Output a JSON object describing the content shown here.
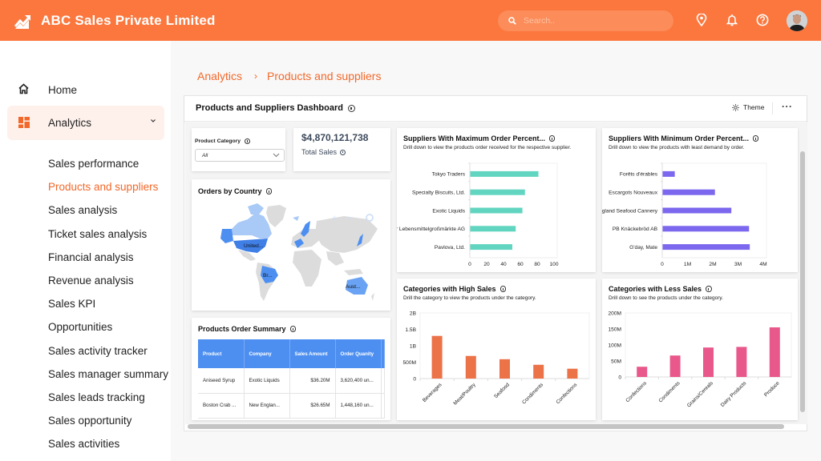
{
  "header": {
    "brand_title": "ABC Sales Private Limited",
    "search_placeholder": "Search..",
    "icons": [
      "trending-up-icon",
      "search-icon",
      "location-pin-icon",
      "bell-icon",
      "help-icon",
      "user-avatar"
    ]
  },
  "sidebar": {
    "home_label": "Home",
    "analytics_label": "Analytics",
    "sub_items": [
      {
        "label": "Sales performance",
        "active": false
      },
      {
        "label": "Products and suppliers",
        "active": true
      },
      {
        "label": "Sales analysis",
        "active": false
      },
      {
        "label": "Ticket sales analysis",
        "active": false
      },
      {
        "label": "Financial analysis",
        "active": false
      },
      {
        "label": "Revenue analysis",
        "active": false
      },
      {
        "label": "Sales KPI",
        "active": false
      },
      {
        "label": "Opportunities",
        "active": false
      },
      {
        "label": "Sales activity tracker",
        "active": false
      },
      {
        "label": "Sales manager summary",
        "active": false
      },
      {
        "label": "Sales leads tracking",
        "active": false
      },
      {
        "label": "Sales opportunity",
        "active": false
      },
      {
        "label": "Sales activities",
        "active": false
      }
    ]
  },
  "breadcrumb": {
    "items": [
      "Analytics",
      "Products and suppliers"
    ],
    "separator": "›"
  },
  "dashboard": {
    "title": "Products and Suppliers Dashboard",
    "theme_label": "Theme",
    "more_label": "···",
    "filter": {
      "label": "Product Category",
      "selected": "All"
    },
    "kpi": {
      "value": "$4,870,121,738",
      "label": "Total Sales"
    },
    "map": {
      "title": "Orders by Country",
      "labels": [
        "United...",
        "Br...",
        "Aust..."
      ],
      "zoom_controls": [
        "+",
        "−",
        "reset"
      ]
    },
    "table": {
      "title": "Products Order Summary",
      "columns": [
        "Product",
        "Company",
        "Sales Amount",
        "Order Quanity"
      ],
      "rows": [
        [
          "Aniseed Syrup",
          "Exotic Liquids",
          "$36.20M",
          "3,620,400 un..."
        ],
        [
          "Boston Crab ...",
          "New Englan...",
          "$26.65M",
          "1,448,160 un..."
        ]
      ]
    }
  },
  "colors": {
    "brand": "#fb773d",
    "accent_text": "#f2682a",
    "teal_bar": "#62d5c0",
    "purple_bar": "#7b68ee",
    "orange_bar": "#ec7248",
    "pink_bar": "#e9588b",
    "table_header": "#4d8ff0"
  },
  "chart_data": [
    {
      "id": "max-order",
      "type": "bar",
      "orientation": "horizontal",
      "title": "Suppliers With Maximum Order Percent...",
      "subtitle": "Drill down to view the products order received for the respective supplier.",
      "categories": [
        "Tokyo Traders",
        "Specialty Biscuits, Ltd.",
        "Exotic Liquids",
        "Plutzer Lebensmittelgroßmärkte AG",
        "Pavlova, Ltd."
      ],
      "values": [
        81,
        65,
        62,
        54,
        50
      ],
      "xlim": [
        0,
        100
      ],
      "ticks": [
        0,
        20,
        40,
        60,
        80,
        100
      ],
      "tick_labels": [
        "0",
        "20",
        "40",
        "60",
        "80",
        "100"
      ]
    },
    {
      "id": "min-order",
      "type": "bar",
      "orientation": "horizontal",
      "title": "Suppliers With Minimum Order Percent...",
      "subtitle": "Drill down to view the products with least demand by order.",
      "categories": [
        "Forêts d'érables",
        "Escargots Nouveaux",
        "New England Seafood Cannery",
        "PB Knäckebröd AB",
        "G'day, Mate"
      ],
      "values": [
        480000,
        2070000,
        2720000,
        3420000,
        3450000
      ],
      "xlim": [
        0,
        4000000
      ],
      "ticks": [
        0,
        1000000,
        2000000,
        3000000,
        4000000
      ],
      "tick_labels": [
        "0",
        "1M",
        "2M",
        "3M",
        "4M"
      ]
    },
    {
      "id": "high-sales",
      "type": "bar",
      "orientation": "vertical",
      "title": "Categories with High Sales",
      "subtitle": "Drill the category to view the products under the category.",
      "categories": [
        "Beverages",
        "Meat/Poultry",
        "Seafood",
        "Condiments",
        "Confections"
      ],
      "values": [
        1300000000,
        690000000,
        590000000,
        420000000,
        300000000
      ],
      "ylim": [
        0,
        2000000000
      ],
      "ticks": [
        0,
        500000000,
        1000000000,
        1500000000,
        2000000000
      ],
      "tick_labels": [
        "0",
        "500M",
        "1B",
        "1.5B",
        "2B"
      ]
    },
    {
      "id": "less-sales",
      "type": "bar",
      "orientation": "vertical",
      "title": "Categories with Less Sales",
      "subtitle": "Drill down to see the products under the category.",
      "categories": [
        "Confections",
        "Condiments",
        "Grains/Cereals",
        "Dairy Products",
        "Produce"
      ],
      "values": [
        32000000,
        67000000,
        92000000,
        94000000,
        155000000
      ],
      "ylim": [
        0,
        200000000
      ],
      "ticks": [
        0,
        50000000,
        100000000,
        150000000,
        200000000
      ],
      "tick_labels": [
        "0",
        "50M",
        "100M",
        "150M",
        "200M"
      ]
    }
  ]
}
